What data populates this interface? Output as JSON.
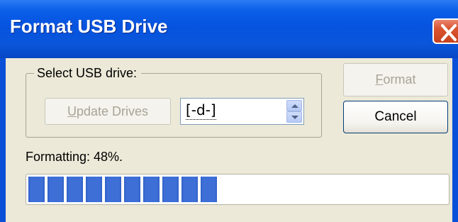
{
  "window": {
    "title": "Format USB Drive"
  },
  "group": {
    "label": "Select USB drive:"
  },
  "buttons": {
    "update_accel": "U",
    "update_rest": "pdate Drives",
    "format_accel": "F",
    "format_rest": "ormat",
    "cancel": "Cancel"
  },
  "drive_select": {
    "value": "[-d-]"
  },
  "status": {
    "text": "Formatting: 48%.",
    "progress_percent": 48
  },
  "colors": {
    "titlebar": "#0653df",
    "progress_fill": "#3d6fd7",
    "close_button": "#d9542f"
  }
}
